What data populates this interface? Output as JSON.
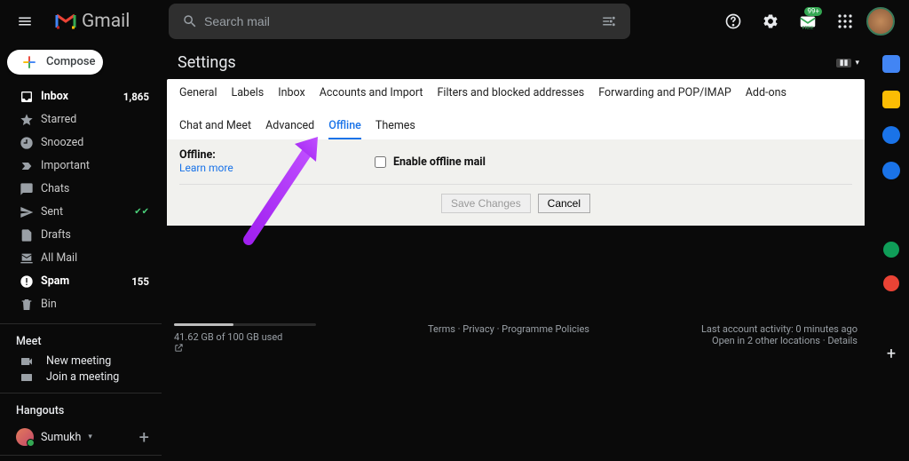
{
  "header": {
    "app_name": "Gmail",
    "search_placeholder": "Search mail",
    "notif_count": "99+"
  },
  "sidebar": {
    "compose_label": "Compose",
    "items": [
      {
        "icon": "inbox",
        "label": "Inbox",
        "count": "1,865",
        "bold": true
      },
      {
        "icon": "star",
        "label": "Starred",
        "count": "",
        "bold": false
      },
      {
        "icon": "clock",
        "label": "Snoozed",
        "count": "",
        "bold": false
      },
      {
        "icon": "important",
        "label": "Important",
        "count": "",
        "bold": false
      },
      {
        "icon": "chat",
        "label": "Chats",
        "count": "",
        "bold": false
      },
      {
        "icon": "send",
        "label": "Sent",
        "count": "",
        "bold": false,
        "sent_checks": true
      },
      {
        "icon": "draft",
        "label": "Drafts",
        "count": "",
        "bold": false
      },
      {
        "icon": "allmail",
        "label": "All Mail",
        "count": "",
        "bold": false
      },
      {
        "icon": "spam",
        "label": "Spam",
        "count": "155",
        "bold": true
      },
      {
        "icon": "bin",
        "label": "Bin",
        "count": "",
        "bold": false
      }
    ],
    "meet_title": "Meet",
    "meet_new": "New meeting",
    "meet_join": "Join a meeting",
    "hangouts_title": "Hangouts",
    "hangouts_user": "Sumukh"
  },
  "settings": {
    "title": "Settings",
    "lang_flag": "🏳",
    "tabs": [
      "General",
      "Labels",
      "Inbox",
      "Accounts and Import",
      "Filters and blocked addresses",
      "Forwarding and POP/IMAP",
      "Add-ons",
      "Chat and Meet",
      "Advanced",
      "Offline",
      "Themes"
    ],
    "active_tab": "Offline",
    "section_label": "Offline:",
    "learn_more": "Learn more",
    "checkbox_label": "Enable offline mail",
    "save_label": "Save Changes",
    "cancel_label": "Cancel"
  },
  "footer": {
    "storage_text": "41.62 GB of 100 GB used",
    "terms": "Terms",
    "privacy": "Privacy",
    "policies": "Programme Policies",
    "activity": "Last account activity: 0 minutes ago",
    "locations": "Open in 2 other locations",
    "details": "Details"
  },
  "accent": "#1a73e8"
}
